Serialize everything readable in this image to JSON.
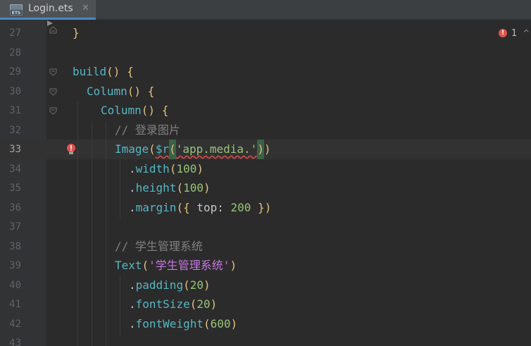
{
  "tab": {
    "filename": "Login.ets",
    "icon": "ets-file-icon",
    "close_glyph": "✕"
  },
  "status": {
    "error_count": "1",
    "error_icon_glyph": "!",
    "chevron_glyph": "^"
  },
  "colors": {
    "background": "#2b2b2b",
    "gutter": "#313335",
    "function": "#56b6c2",
    "bracket": "#e5c07b",
    "string": "#98c379",
    "string_cn": "#c678dd",
    "comment": "#808080",
    "error": "#e0544d",
    "tab_accent": "#4a88c7"
  },
  "lines": [
    {
      "num": "27",
      "text": "}"
    },
    {
      "num": "28",
      "text": ""
    },
    {
      "num": "29",
      "text": "build() {"
    },
    {
      "num": "30",
      "text": "Column() {"
    },
    {
      "num": "31",
      "text": "Column() {"
    },
    {
      "num": "32",
      "text": "// 登录图片"
    },
    {
      "num": "33",
      "text": "Image($r('app.media.'))"
    },
    {
      "num": "34",
      "text": ".width(100)"
    },
    {
      "num": "35",
      "text": ".height(100)"
    },
    {
      "num": "36",
      "text": ".margin({ top: 200 })"
    },
    {
      "num": "37",
      "text": ""
    },
    {
      "num": "38",
      "text": "// 学生管理系统"
    },
    {
      "num": "39",
      "text": "Text('学生管理系统')"
    },
    {
      "num": "40",
      "text": ".padding(20)"
    },
    {
      "num": "41",
      "text": ".fontSize(20)"
    },
    {
      "num": "42",
      "text": ".fontWeight(600)"
    },
    {
      "num": "43",
      "text": ""
    }
  ],
  "tokens": {
    "l27": {
      "brace": "}"
    },
    "l29": {
      "fn": "build",
      "paren": "()",
      "brace": "{"
    },
    "l30": {
      "fn": "Column",
      "paren": "()",
      "brace": "{"
    },
    "l31": {
      "fn": "Column",
      "paren": "()",
      "brace": "{"
    },
    "l32": {
      "comment": "// 登录图片"
    },
    "l33": {
      "fn": "Image",
      "open": "(",
      "r": "$r",
      "inner_open": "(",
      "str": "'app.media.'",
      "inner_close": ")",
      "close": ")"
    },
    "l34": {
      "dot": ".",
      "fn": "width",
      "open": "(",
      "num": "100",
      "close": ")"
    },
    "l35": {
      "dot": ".",
      "fn": "height",
      "open": "(",
      "num": "100",
      "close": ")"
    },
    "l36": {
      "dot": ".",
      "fn": "margin",
      "open": "(",
      "brace_open": "{",
      "key": " top: ",
      "num": "200",
      "brace_close": " }",
      "close": ")"
    },
    "l38": {
      "comment": "// 学生管理系统"
    },
    "l39": {
      "fn": "Text",
      "open": "(",
      "str": "'学生管理系统'",
      "close": ")"
    },
    "l40": {
      "dot": ".",
      "fn": "padding",
      "open": "(",
      "num": "20",
      "close": ")"
    },
    "l41": {
      "dot": ".",
      "fn": "fontSize",
      "open": "(",
      "num": "20",
      "close": ")"
    },
    "l42": {
      "dot": ".",
      "fn": "fontWeight",
      "open": "(",
      "num": "600",
      "close": ")"
    }
  }
}
